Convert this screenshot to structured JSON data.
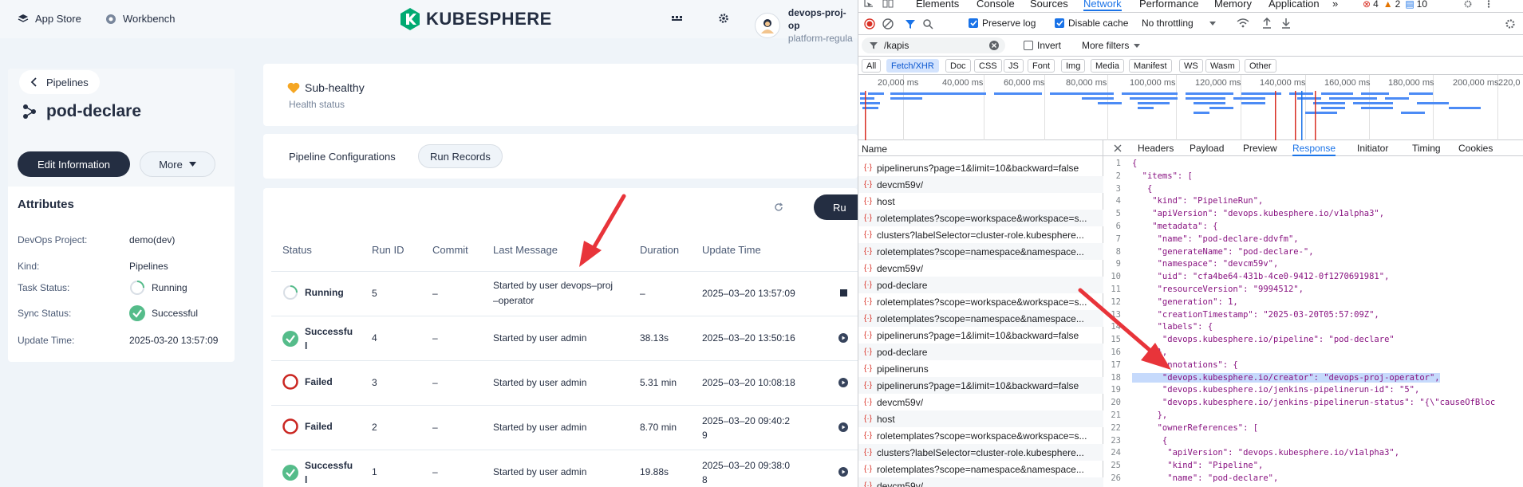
{
  "topbar": {
    "app_store": "App Store",
    "workbench": "Workbench",
    "logo": "KUBESPHERE",
    "user_name": "devops-proj-op",
    "user_role": "platform-regula"
  },
  "sidebar": {
    "breadcrumb": "Pipelines",
    "pipeline_name": "pod-declare",
    "edit_button": "Edit Information",
    "more_button": "More",
    "attributes_title": "Attributes",
    "attributes": [
      {
        "key": "DevOps Project:",
        "value": "demo(dev)"
      },
      {
        "key": "Kind:",
        "value": "Pipelines"
      },
      {
        "key": "Task Status:",
        "value": "Running"
      },
      {
        "key": "Sync Status:",
        "value": "Successful"
      },
      {
        "key": "Update Time:",
        "value": "2025-03-20 13:57:09"
      }
    ]
  },
  "health": {
    "status": "Sub-healthy",
    "label": "Health status"
  },
  "tabs": {
    "configurations": "Pipeline Configurations",
    "run_records": "Run Records"
  },
  "records": {
    "run_button": "Ru",
    "columns": [
      "Status",
      "Run ID",
      "Commit",
      "Last Message",
      "Duration",
      "Update Time"
    ],
    "rows": [
      {
        "status": "Running",
        "run_id": "5",
        "commit": "–",
        "message": "Started by user devops–proj\n–operator",
        "duration": "–",
        "time": "2025–03–20 13:57:09"
      },
      {
        "status": "Successfu\nl",
        "run_id": "4",
        "commit": "–",
        "message": "Started by user admin",
        "duration": "38.13s",
        "time": "2025–03–20 13:50:16"
      },
      {
        "status": "Failed",
        "run_id": "3",
        "commit": "–",
        "message": "Started by user admin",
        "duration": "5.31 min",
        "time": "2025–03–20 10:08:18"
      },
      {
        "status": "Failed",
        "run_id": "2",
        "commit": "–",
        "message": "Started by user admin",
        "duration": "8.70 min",
        "time": "2025–03–20 09:40:2\n9"
      },
      {
        "status": "Successfu\nl",
        "run_id": "1",
        "commit": "–",
        "message": "Started by user admin",
        "duration": "19.88s",
        "time": "2025–03–20 09:38:0\n8"
      }
    ]
  },
  "devtools": {
    "tabs": [
      "Elements",
      "Console",
      "Sources",
      "Network",
      "Performance",
      "Memory",
      "Application"
    ],
    "more_tabs": "»",
    "badges": {
      "errors": "4",
      "warnings": "2",
      "messages": "10"
    },
    "preserve_log": "Preserve log",
    "disable_cache": "Disable cache",
    "throttling": "No throttling",
    "filter_value": "/kapis",
    "invert": "Invert",
    "more_filters": "More filters",
    "types": [
      "All",
      "Fetch/XHR",
      "Doc",
      "CSS",
      "JS",
      "Font",
      "Img",
      "Media",
      "Manifest",
      "WS",
      "Wasm",
      "Other"
    ],
    "timeline_ticks": [
      "20,000 ms",
      "40,000 ms",
      "60,000 ms",
      "80,000 ms",
      "100,000 ms",
      "120,000 ms",
      "140,000 ms",
      "160,000 ms",
      "180,000 ms",
      "200,000 ms",
      "220,0"
    ],
    "name_header": "Name",
    "requests": [
      "pipelineruns?page=1&limit=10&backward=false",
      "devcm59v/",
      "host",
      "roletemplates?scope=workspace&workspace=s...",
      "clusters?labelSelector=cluster-role.kubesphere...",
      "roletemplates?scope=namespace&namespace...",
      "devcm59v/",
      "pod-declare",
      "roletemplates?scope=workspace&workspace=s...",
      "roletemplates?scope=namespace&namespace...",
      "pipelineruns?page=1&limit=10&backward=false",
      "pod-declare",
      "pipelineruns",
      "pipelineruns?page=1&limit=10&backward=false",
      "devcm59v/",
      "host",
      "roletemplates?scope=workspace&workspace=s...",
      "clusters?labelSelector=cluster-role.kubesphere...",
      "roletemplates?scope=namespace&namespace...",
      "devcm59v/"
    ],
    "detail_tabs": [
      "Headers",
      "Payload",
      "Preview",
      "Response",
      "Initiator",
      "Timing",
      "Cookies"
    ],
    "response_lines": [
      "{",
      "  \"items\": [",
      "   {",
      "    \"kind\": \"PipelineRun\",",
      "    \"apiVersion\": \"devops.kubesphere.io/v1alpha3\",",
      "    \"metadata\": {",
      "     \"name\": \"pod-declare-ddvfm\",",
      "     \"generateName\": \"pod-declare-\",",
      "     \"namespace\": \"devcm59v\",",
      "     \"uid\": \"cfa4be64-431b-4ce0-9412-0f1270691981\",",
      "     \"resourceVersion\": \"9994512\",",
      "     \"generation\": 1,",
      "     \"creationTimestamp\": \"2025-03-20T05:57:09Z\",",
      "     \"labels\": {",
      "      \"devops.kubesphere.io/pipeline\": \"pod-declare\"",
      "     },",
      "     \"annotations\": {",
      "      \"devops.kubesphere.io/creator\": \"devops-proj-operator\",",
      "      \"devops.kubesphere.io/jenkins-pipelinerun-id\": \"5\",",
      "      \"devops.kubesphere.io/jenkins-pipelinerun-status\": \"{\\\"causeOfBloc",
      "     },",
      "     \"ownerReferences\": [",
      "      {",
      "       \"apiVersion\": \"devops.kubesphere.io/v1alpha3\",",
      "       \"kind\": \"Pipeline\",",
      "       \"name\": \"pod-declare\","
    ]
  }
}
